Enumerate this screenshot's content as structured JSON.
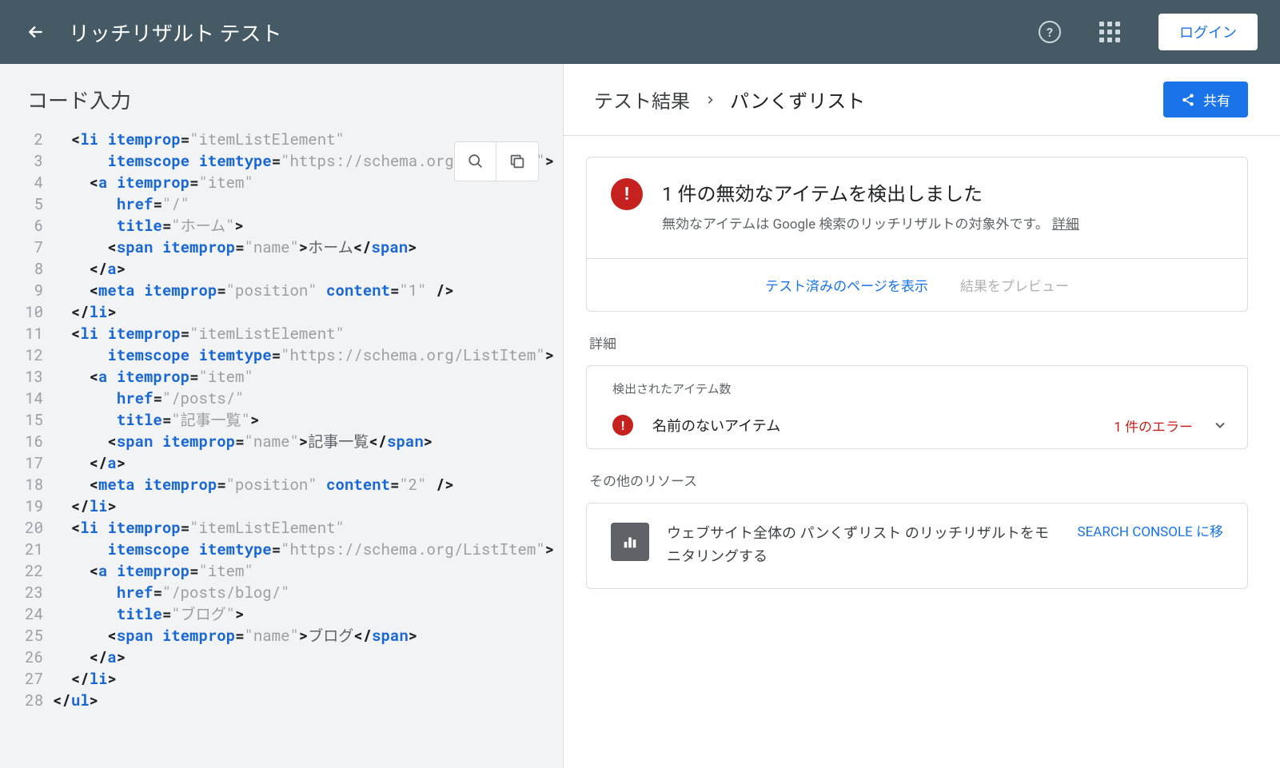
{
  "header": {
    "title": "リッチリザルト テスト",
    "login": "ログイン"
  },
  "left": {
    "title": "コード入力"
  },
  "code": [
    {
      "n": 2,
      "html": "  <span class='t-pun'>&lt;</span><span class='t-tag'>li</span> <span class='t-attr'>itemprop</span><span class='t-pun'>=</span><span class='t-str'>\"itemListElement\"</span>"
    },
    {
      "n": 3,
      "html": "      <span class='t-attr'>itemscope</span> <span class='t-attr'>itemtype</span><span class='t-pun'>=</span><span class='t-str'>\"https://schema.org/ListItem\"</span><span class='t-pun'>&gt;</span>"
    },
    {
      "n": 4,
      "html": "    <span class='t-pun'>&lt;</span><span class='t-tag'>a</span> <span class='t-attr'>itemprop</span><span class='t-pun'>=</span><span class='t-str'>\"item\"</span>"
    },
    {
      "n": 5,
      "html": "       <span class='t-attr'>href</span><span class='t-pun'>=</span><span class='t-str'>\"/\"</span>"
    },
    {
      "n": 6,
      "html": "       <span class='t-attr'>title</span><span class='t-pun'>=</span><span class='t-str'>\"ホーム\"</span><span class='t-pun'>&gt;</span>"
    },
    {
      "n": 7,
      "html": "      <span class='t-pun'>&lt;</span><span class='t-tag'>span</span> <span class='t-attr'>itemprop</span><span class='t-pun'>=</span><span class='t-str'>\"name\"</span><span class='t-pun'>&gt;</span><span class='t-txt'>ホーム</span><span class='t-pun'>&lt;/</span><span class='t-tag'>span</span><span class='t-pun'>&gt;</span>"
    },
    {
      "n": 8,
      "html": "    <span class='t-pun'>&lt;/</span><span class='t-tag'>a</span><span class='t-pun'>&gt;</span>"
    },
    {
      "n": 9,
      "html": "    <span class='t-pun'>&lt;</span><span class='t-tag'>meta</span> <span class='t-attr'>itemprop</span><span class='t-pun'>=</span><span class='t-str'>\"position\"</span> <span class='t-attr'>content</span><span class='t-pun'>=</span><span class='t-str'>\"1\"</span> <span class='t-pun'>/&gt;</span>"
    },
    {
      "n": 10,
      "html": "  <span class='t-pun'>&lt;/</span><span class='t-tag'>li</span><span class='t-pun'>&gt;</span>"
    },
    {
      "n": 11,
      "html": "  <span class='t-pun'>&lt;</span><span class='t-tag'>li</span> <span class='t-attr'>itemprop</span><span class='t-pun'>=</span><span class='t-str'>\"itemListElement\"</span>"
    },
    {
      "n": 12,
      "html": "      <span class='t-attr'>itemscope</span> <span class='t-attr'>itemtype</span><span class='t-pun'>=</span><span class='t-str'>\"https://schema.org/ListItem\"</span><span class='t-pun'>&gt;</span>"
    },
    {
      "n": 13,
      "html": "    <span class='t-pun'>&lt;</span><span class='t-tag'>a</span> <span class='t-attr'>itemprop</span><span class='t-pun'>=</span><span class='t-str'>\"item\"</span>"
    },
    {
      "n": 14,
      "html": "       <span class='t-attr'>href</span><span class='t-pun'>=</span><span class='t-str'>\"/posts/\"</span>"
    },
    {
      "n": 15,
      "html": "       <span class='t-attr'>title</span><span class='t-pun'>=</span><span class='t-str'>\"記事一覧\"</span><span class='t-pun'>&gt;</span>"
    },
    {
      "n": 16,
      "html": "      <span class='t-pun'>&lt;</span><span class='t-tag'>span</span> <span class='t-attr'>itemprop</span><span class='t-pun'>=</span><span class='t-str'>\"name\"</span><span class='t-pun'>&gt;</span><span class='t-txt'>記事一覧</span><span class='t-pun'>&lt;/</span><span class='t-tag'>span</span><span class='t-pun'>&gt;</span>"
    },
    {
      "n": 17,
      "html": "    <span class='t-pun'>&lt;/</span><span class='t-tag'>a</span><span class='t-pun'>&gt;</span>"
    },
    {
      "n": 18,
      "html": "    <span class='t-pun'>&lt;</span><span class='t-tag'>meta</span> <span class='t-attr'>itemprop</span><span class='t-pun'>=</span><span class='t-str'>\"position\"</span> <span class='t-attr'>content</span><span class='t-pun'>=</span><span class='t-str'>\"2\"</span> <span class='t-pun'>/&gt;</span>"
    },
    {
      "n": 19,
      "html": "  <span class='t-pun'>&lt;/</span><span class='t-tag'>li</span><span class='t-pun'>&gt;</span>"
    },
    {
      "n": 20,
      "html": "  <span class='t-pun'>&lt;</span><span class='t-tag'>li</span> <span class='t-attr'>itemprop</span><span class='t-pun'>=</span><span class='t-str'>\"itemListElement\"</span>"
    },
    {
      "n": 21,
      "html": "      <span class='t-attr'>itemscope</span> <span class='t-attr'>itemtype</span><span class='t-pun'>=</span><span class='t-str'>\"https://schema.org/ListItem\"</span><span class='t-pun'>&gt;</span>"
    },
    {
      "n": 22,
      "html": "    <span class='t-pun'>&lt;</span><span class='t-tag'>a</span> <span class='t-attr'>itemprop</span><span class='t-pun'>=</span><span class='t-str'>\"item\"</span>"
    },
    {
      "n": 23,
      "html": "       <span class='t-attr'>href</span><span class='t-pun'>=</span><span class='t-str'>\"/posts/blog/\"</span>"
    },
    {
      "n": 24,
      "html": "       <span class='t-attr'>title</span><span class='t-pun'>=</span><span class='t-str'>\"ブログ\"</span><span class='t-pun'>&gt;</span>"
    },
    {
      "n": 25,
      "html": "      <span class='t-pun'>&lt;</span><span class='t-tag'>span</span> <span class='t-attr'>itemprop</span><span class='t-pun'>=</span><span class='t-str'>\"name\"</span><span class='t-pun'>&gt;</span><span class='t-txt'>ブログ</span><span class='t-pun'>&lt;/</span><span class='t-tag'>span</span><span class='t-pun'>&gt;</span>"
    },
    {
      "n": 26,
      "html": "    <span class='t-pun'>&lt;/</span><span class='t-tag'>a</span><span class='t-pun'>&gt;</span>"
    },
    {
      "n": 27,
      "html": "  <span class='t-pun'>&lt;/</span><span class='t-tag'>li</span><span class='t-pun'>&gt;</span>"
    },
    {
      "n": 28,
      "html": "<span class='t-pun'>&lt;/</span><span class='t-tag'>ul</span><span class='t-pun'>&gt;</span>"
    }
  ],
  "right": {
    "breadcrumb_root": "テスト結果",
    "breadcrumb_current": "パンくずリスト",
    "share": "共有",
    "alert_title": "1 件の無効なアイテムを検出しました",
    "alert_desc_1": "無効なアイテムは Google 検索のリッチリザルトの対象外です。",
    "alert_link": "詳細",
    "action_view": "テスト済みのページを表示",
    "action_preview": "結果をプレビュー",
    "section_details": "詳細",
    "detail_header": "検出されたアイテム数",
    "detail_name": "名前のないアイテム",
    "detail_count": "1 件のエラー",
    "section_other": "その他のリソース",
    "promo_text": "ウェブサイト全体の パンくずリスト のリッチリザルトをモニタリングする",
    "promo_link": "SEARCH CONSOLE に移"
  }
}
